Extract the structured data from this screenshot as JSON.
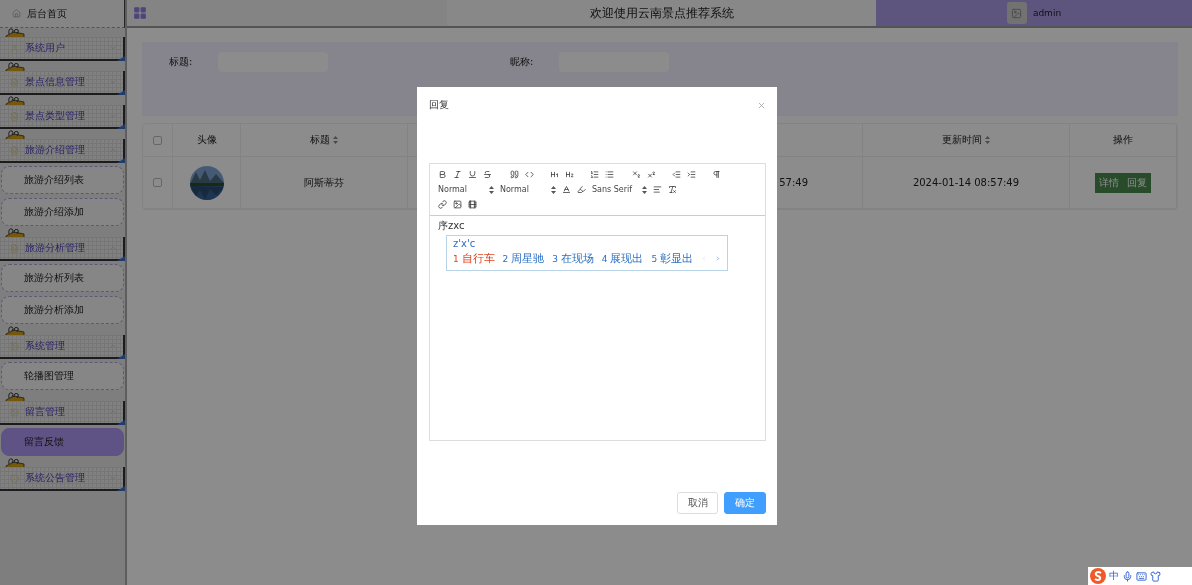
{
  "sidebar": {
    "items": [
      {
        "label": "后台首页",
        "kind": "home"
      },
      {
        "label": "系统用户",
        "kind": "section",
        "expanded": false
      },
      {
        "label": "景点信息管理",
        "kind": "section",
        "expanded": false
      },
      {
        "label": "景点类型管理",
        "kind": "section",
        "expanded": false
      },
      {
        "label": "旅游介绍管理",
        "kind": "section",
        "expanded": true,
        "children": [
          {
            "label": "旅游介绍列表",
            "selected": false
          },
          {
            "label": "旅游介绍添加",
            "selected": false
          }
        ]
      },
      {
        "label": "旅游分析管理",
        "kind": "section",
        "expanded": true,
        "children": [
          {
            "label": "旅游分析列表",
            "selected": false
          },
          {
            "label": "旅游分析添加",
            "selected": false
          }
        ]
      },
      {
        "label": "系统管理",
        "kind": "section",
        "expanded": true,
        "children": [
          {
            "label": "轮播图管理",
            "selected": false
          }
        ]
      },
      {
        "label": "留言管理",
        "kind": "section",
        "expanded": true,
        "children": [
          {
            "label": "留言反馈",
            "selected": true
          }
        ]
      },
      {
        "label": "系统公告管理",
        "kind": "section",
        "expanded": false
      }
    ]
  },
  "header": {
    "title": "欢迎使用云南景点推荐系统",
    "user": "admin"
  },
  "search": {
    "fields": [
      {
        "label": "标题:"
      },
      {
        "label": "昵称:"
      }
    ]
  },
  "table": {
    "all_checked": false,
    "columns": [
      {
        "label": "头像",
        "sortable": false
      },
      {
        "label": "标题",
        "sortable": true
      },
      {
        "label": "更新时间",
        "sortable": true
      },
      {
        "label": "操作",
        "sortable": false
      }
    ],
    "rows": [
      {
        "checked": false,
        "title": "阿斯蒂芬",
        "column_4": "57:49",
        "updated": "2024-01-14 08:57:49",
        "actions": [
          "详情",
          "回复"
        ]
      }
    ]
  },
  "dialog": {
    "title": "回复",
    "pickers": [
      "Normal",
      "Normal",
      "Sans Serif"
    ],
    "content": "序zxc",
    "ime": {
      "composition": "z'x'c",
      "candidates": [
        {
          "index": "1",
          "text": "自行车",
          "selected": true
        },
        {
          "index": "2",
          "text": "周星驰",
          "selected": false
        },
        {
          "index": "3",
          "text": "在现场",
          "selected": false
        },
        {
          "index": "4",
          "text": "展现出",
          "selected": false
        },
        {
          "index": "5",
          "text": "彰显出",
          "selected": false
        }
      ]
    },
    "buttons": [
      {
        "label": "取消",
        "primary": false
      },
      {
        "label": "确定",
        "primary": true
      }
    ]
  },
  "ime_status": {
    "mode": "中"
  }
}
